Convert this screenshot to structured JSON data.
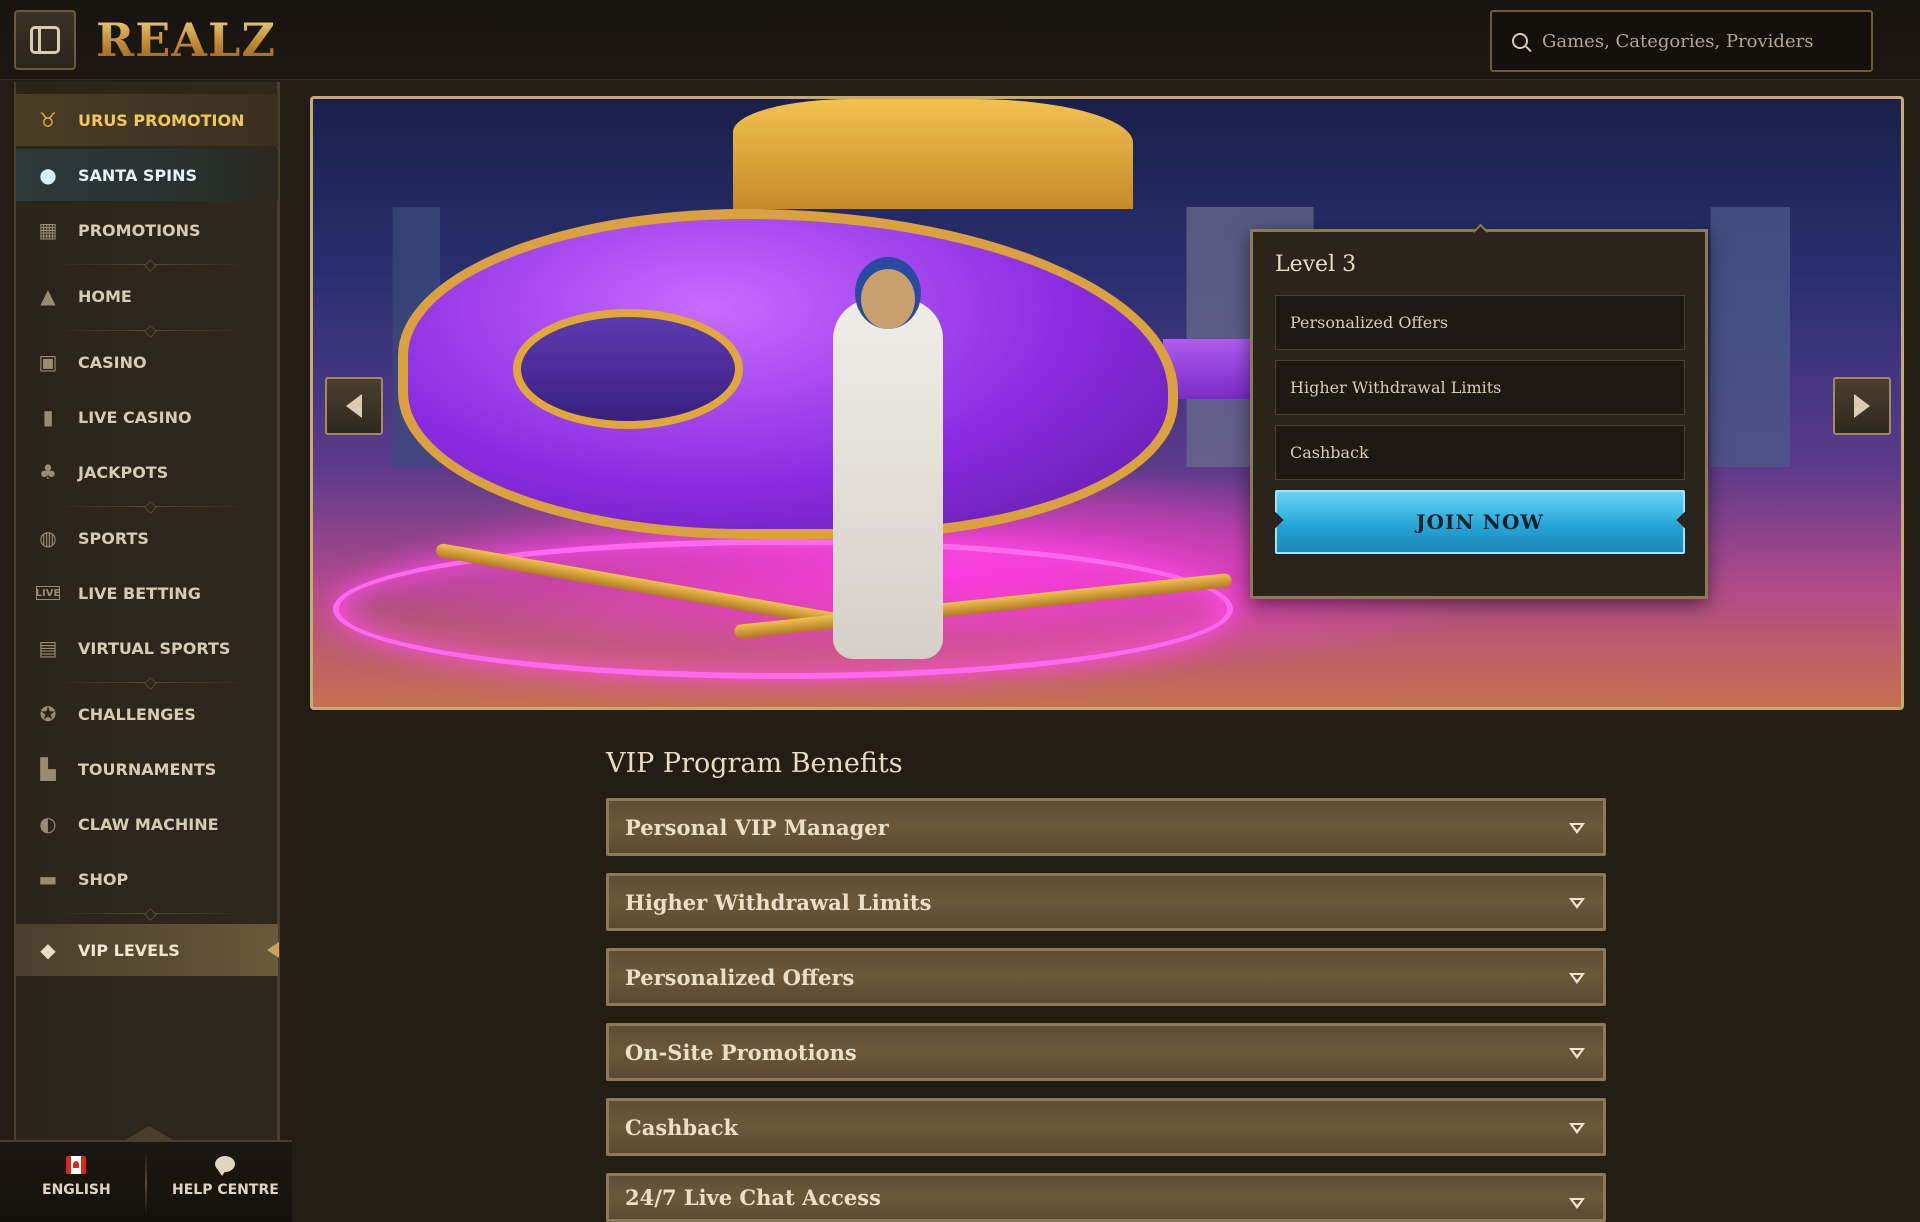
{
  "header": {
    "logo": "REALZ",
    "search_placeholder": "Games, Categories, Providers"
  },
  "sidebar": {
    "items": [
      {
        "label": "URUS PROMOTION",
        "icon": "bull-icon"
      },
      {
        "label": "SANTA SPINS",
        "icon": "ornament-icon"
      },
      {
        "label": "PROMOTIONS",
        "icon": "gift-icon"
      },
      {
        "label": "HOME",
        "icon": "pyramid-icon"
      },
      {
        "label": "CASINO",
        "icon": "slot-machine-icon"
      },
      {
        "label": "LIVE CASINO",
        "icon": "card-icon"
      },
      {
        "label": "JACKPOTS",
        "icon": "clover-icon"
      },
      {
        "label": "SPORTS",
        "icon": "ball-icon"
      },
      {
        "label": "LIVE BETTING",
        "icon": "live-icon"
      },
      {
        "label": "VIRTUAL SPORTS",
        "icon": "virtual-icon"
      },
      {
        "label": "CHALLENGES",
        "icon": "badge-icon"
      },
      {
        "label": "TOURNAMENTS",
        "icon": "podium-icon"
      },
      {
        "label": "CLAW MACHINE",
        "icon": "claw-icon"
      },
      {
        "label": "SHOP",
        "icon": "bag-icon"
      },
      {
        "label": "VIP LEVELS",
        "icon": "diamond-icon"
      }
    ],
    "language": "ENGLISH",
    "help": "HELP CENTRE"
  },
  "banner": {
    "level_title": "Level 3",
    "benefits": [
      "Personalized Offers",
      "Higher Withdrawal Limits",
      "Cashback"
    ],
    "join_label": "JOIN NOW"
  },
  "vip": {
    "title": "VIP Program Benefits",
    "items": [
      "Personal VIP Manager",
      "Higher Withdrawal Limits",
      "Personalized Offers",
      "On-Site Promotions",
      "Cashback",
      "24/7 Live Chat Access"
    ]
  },
  "colors": {
    "accent_gold": "#c9a873",
    "join_blue": "#27a6d8",
    "background": "#231d14"
  }
}
